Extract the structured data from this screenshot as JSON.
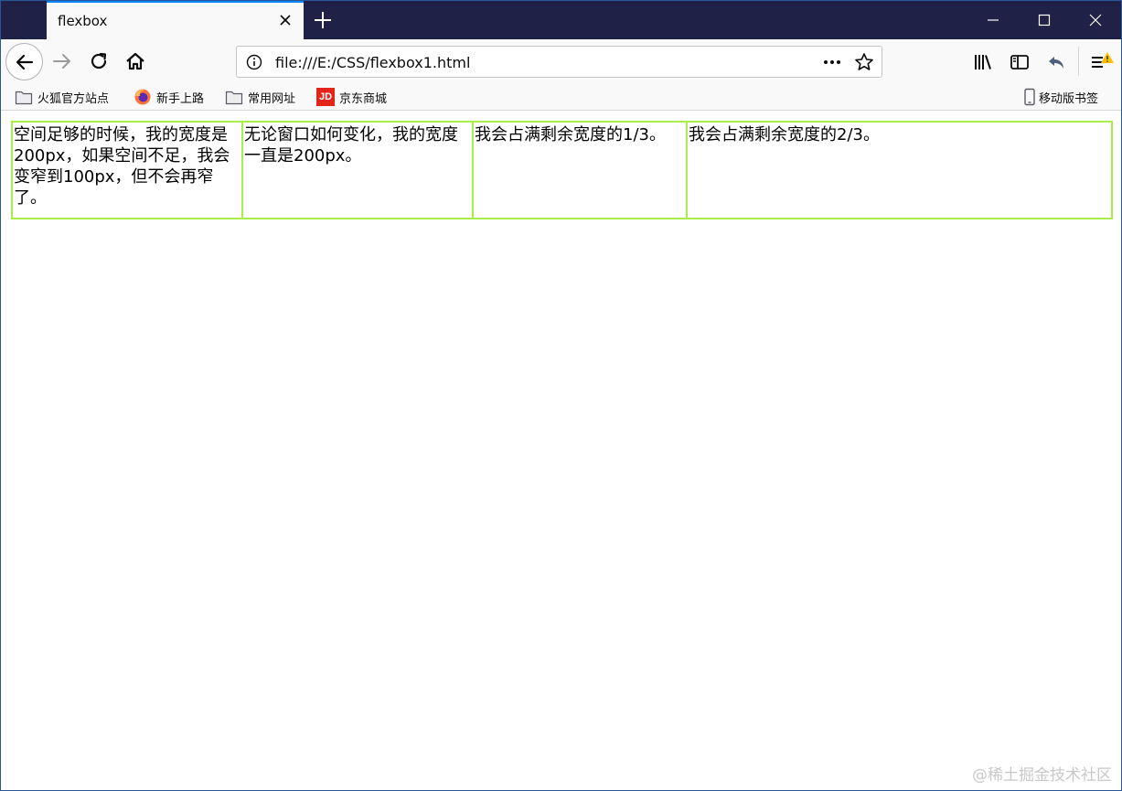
{
  "browser": {
    "tab": {
      "title": "flexbox"
    },
    "urlbar": {
      "url": "file:///E:/CSS/flexbox1.html"
    },
    "bookmarks": [
      {
        "label": "火狐官方站点",
        "icon": "folder-icon"
      },
      {
        "label": "新手上路",
        "icon": "firefox-icon"
      },
      {
        "label": "常用网址",
        "icon": "folder-icon"
      },
      {
        "label": "京东商城",
        "icon": "jd-icon",
        "icon_text": "JD"
      }
    ],
    "mobile_bookmarks": "移动版书签"
  },
  "page": {
    "items": [
      "空间足够的时候，我的宽度是200px，如果空间不足，我会变窄到100px，但不会再窄了。",
      "无论窗口如何变化，我的宽度一直是200px。",
      "我会占满剩余宽度的1/3。",
      "我会占满剩余宽度的2/3。"
    ],
    "border_color": "#a9ef4a"
  },
  "watermark": "@稀土掘金技术社区"
}
